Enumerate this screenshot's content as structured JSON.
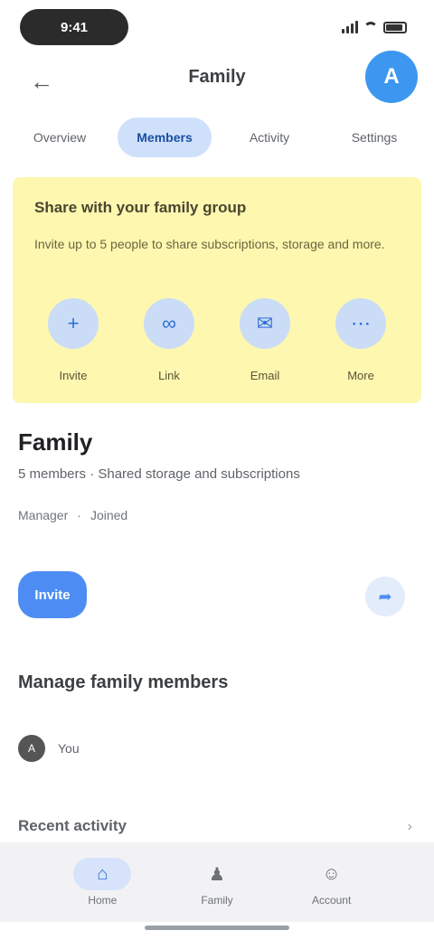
{
  "status_bar": {
    "time": "9:41"
  },
  "app_bar": {
    "back_icon": "arrow-back-icon",
    "title": "Family",
    "avatar_initial": "A"
  },
  "tabs": [
    {
      "label": "Overview",
      "active": false
    },
    {
      "label": "Members",
      "active": true
    },
    {
      "label": "Activity",
      "active": false
    },
    {
      "label": "Settings",
      "active": false
    }
  ],
  "share_card": {
    "title": "Share with your family group",
    "description": "Invite up to 5 people to share subscriptions, storage and more.",
    "background": "#fdf7b0",
    "actions": [
      {
        "label": "Invite",
        "icon": "person-add-icon"
      },
      {
        "label": "Link",
        "icon": "link-icon"
      },
      {
        "label": "Email",
        "icon": "mail-icon"
      },
      {
        "label": "More",
        "icon": "more-icon"
      }
    ]
  },
  "group": {
    "title": "Family",
    "subtitle": "5 members · Shared storage and subscriptions",
    "meta_left": "Manager",
    "meta_sep": "·",
    "meta_right": "Joined"
  },
  "actions": {
    "primary_label": "Invite",
    "share_icon": "share-icon"
  },
  "manage": {
    "title": "Manage family members",
    "subtitle": "",
    "member": {
      "initial": "A",
      "name": "You",
      "role": ""
    }
  },
  "recent": {
    "title": "Recent activity"
  },
  "bottom_nav": [
    {
      "label": "Home",
      "icon": "home-icon",
      "active": true
    },
    {
      "label": "Family",
      "icon": "family-icon",
      "active": false
    },
    {
      "label": "Account",
      "icon": "account-icon",
      "active": false
    }
  ],
  "colors": {
    "accent": "#4d8df3",
    "tab_active_bg": "#cfe0fb",
    "avatar": "#3d97f0"
  }
}
